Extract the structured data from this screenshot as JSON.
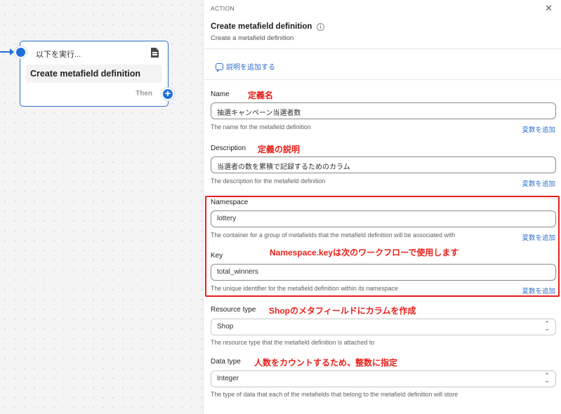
{
  "canvas": {
    "node": {
      "header": "以下を実行...",
      "body": "Create metafield definition",
      "then_label": "Then",
      "add_symbol": "+"
    }
  },
  "panel": {
    "kicker": "ACTION",
    "close_symbol": "✕",
    "title": "Create metafield definition",
    "info_symbol": "i",
    "subtitle": "Create a metafield definition",
    "add_description": "説明を追加する",
    "add_variable_label": "変数を追加",
    "fields": {
      "name": {
        "label": "Name",
        "annotation": "定義名",
        "value": "抽選キャンペーン当選者数",
        "help": "The name for the metafield definition"
      },
      "description": {
        "label": "Description",
        "annotation": "定義の説明",
        "value": "当選者の数を累積で記録するためのカラム",
        "help": "The description for the metafield definition"
      },
      "namespace": {
        "label": "Namespace",
        "value": "lottery",
        "help": "The container for a group of metafields that the metafield definition will be associated with"
      },
      "key": {
        "label": "Key",
        "annotation": "Namespace.keyは次のワークフローで使用します",
        "value": "total_winners",
        "help": "The unique identifier for the metafield definition within its namespace"
      },
      "resource_type": {
        "label": "Resource type",
        "annotation": "Shopのメタフィールドにカラムを作成",
        "value": "Shop",
        "help": "The resource type that the metafield definition is attached to"
      },
      "data_type": {
        "label": "Data type",
        "annotation": "人数をカウントするため、整数に指定",
        "value": "Integer",
        "help": "The type of data that each of the metafields that belong to the metafield definition will store"
      }
    }
  },
  "colors": {
    "accent": "#2c6ecb",
    "annotation_red": "#e8201a",
    "node_blue": "#1f6fd6"
  }
}
